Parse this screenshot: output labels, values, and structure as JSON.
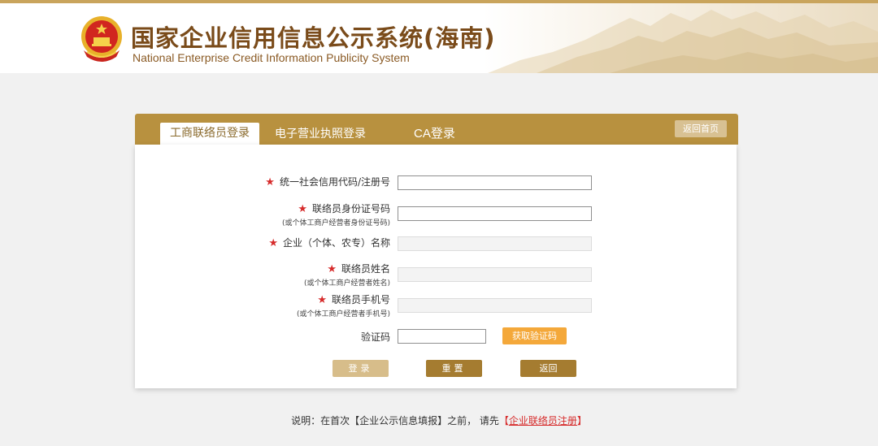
{
  "header": {
    "title_cn": "国家企业信用信息公示系统(海南)",
    "title_en": "National Enterprise Credit Information Publicity System"
  },
  "tabs": [
    {
      "label": "工商联络员登录",
      "active": true
    },
    {
      "label": "电子营业执照登录",
      "active": false
    },
    {
      "label": "CA登录",
      "active": false
    }
  ],
  "home_button": "返回首页",
  "form": {
    "fields": [
      {
        "label": "统一社会信用代码/注册号",
        "sub": "",
        "value": "",
        "required": true,
        "disabled": false
      },
      {
        "label": "联络员身份证号码",
        "sub": "(或个体工商户经营者身份证号码)",
        "value": "",
        "required": true,
        "disabled": false
      },
      {
        "label": "企业（个体、农专）名称",
        "sub": "",
        "value": "",
        "required": true,
        "disabled": true
      },
      {
        "label": "联络员姓名",
        "sub": "(或个体工商户经营者姓名)",
        "value": "",
        "required": true,
        "disabled": true
      },
      {
        "label": "联络员手机号",
        "sub": "(或个体工商户经营者手机号)",
        "value": "",
        "required": true,
        "disabled": true
      }
    ],
    "captcha": {
      "label": "验证码",
      "value": "",
      "button": "获取验证码"
    },
    "buttons": {
      "login": "登录",
      "reset": "重置",
      "back": "返回"
    },
    "required_mark": "★"
  },
  "footer_note": {
    "prefix": "说明：在首次【企业公示信息填报】之前，  请先",
    "link_open": "【",
    "link_text": "企业联络员注册",
    "link_close": "】"
  },
  "colors": {
    "accent_gold": "#b8913f",
    "button_dark": "#a57c30",
    "button_light": "#d7bd8a",
    "captcha_button": "#f4a83a",
    "required_star": "#d62b2b"
  }
}
